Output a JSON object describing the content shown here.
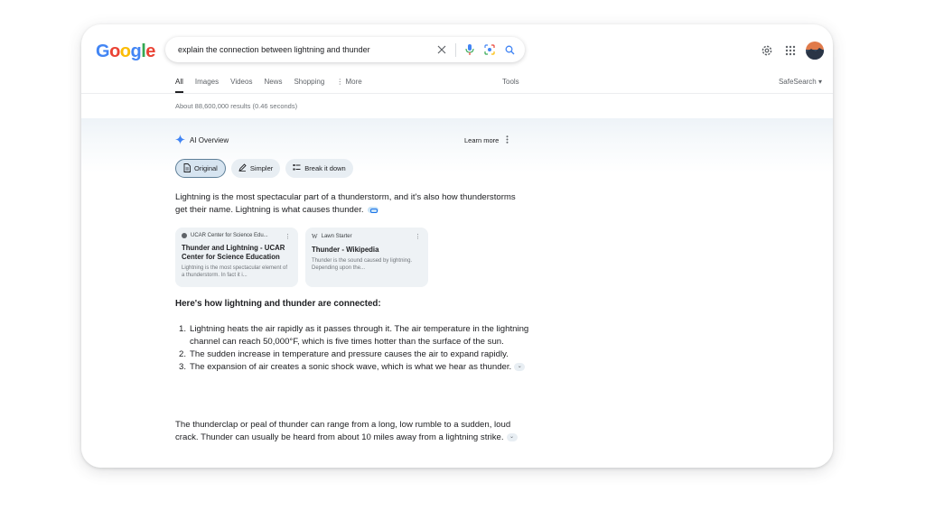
{
  "logo": {
    "letters": [
      "G",
      "o",
      "o",
      "g",
      "l",
      "e"
    ],
    "colors": [
      "#4285F4",
      "#EA4335",
      "#FBBC05",
      "#4285F4",
      "#34A853",
      "#EA4335"
    ]
  },
  "search": {
    "query": "explain the connection between lightning and thunder"
  },
  "tabs": [
    {
      "label": "All",
      "active": true
    },
    {
      "label": "Images"
    },
    {
      "label": "Videos"
    },
    {
      "label": "News"
    },
    {
      "label": "Shopping"
    },
    {
      "label": "⋮ More"
    }
  ],
  "tools_label": "Tools",
  "safesearch_label": "SafeSearch ▾",
  "result_stats": "About 88,600,000 results (0.46 seconds)",
  "ai_overview": {
    "title": "AI Overview",
    "learn_more": "Learn more",
    "chips": [
      {
        "label": "Original",
        "active": true,
        "icon": "document-icon"
      },
      {
        "label": "Simpler",
        "icon": "pen-icon"
      },
      {
        "label": "Break it down",
        "icon": "list-icon"
      }
    ],
    "intro": "Lightning is the most spectacular part of a thunderstorm, and it's also how thunderstorms get their name. Lightning is what causes thunder.",
    "sources": [
      {
        "site": "UCAR Center for Science Edu...",
        "title": "Thunder and Lightning - UCAR Center for Science Education",
        "snippet": "Lightning is the most spectacular element of a thunderstorm. In fact it i..."
      },
      {
        "site": "Lawn Starter",
        "site_glyph": "W",
        "title": "Thunder - Wikipedia",
        "snippet": "Thunder is the sound caused by lightning. Depending upon the..."
      }
    ],
    "subheading": "Here's how lightning and thunder are connected:",
    "steps": [
      "Lightning heats the air rapidly as it passes through it. The air temperature in the lightning channel can reach 50,000°F, which is five times hotter than the surface of the sun.",
      "The sudden increase in temperature and pressure causes the air to expand rapidly.",
      "The expansion of air creates a sonic shock wave, which is what we hear as thunder."
    ],
    "closing": "The thunderclap or peal of thunder can range from a long, low rumble to a sudden, loud crack. Thunder can usually be heard from about 10 miles away from a lightning strike."
  }
}
